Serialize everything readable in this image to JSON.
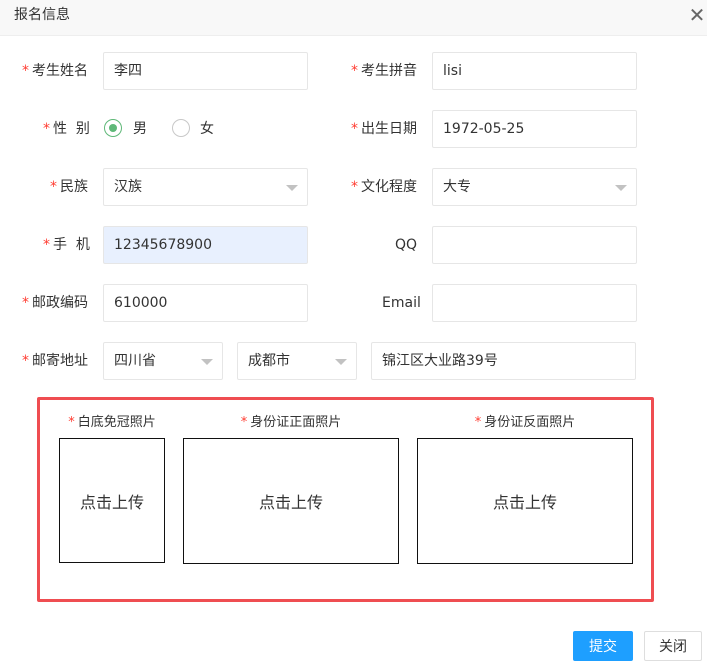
{
  "dialog": {
    "title": "报名信息",
    "close_symbol": "✕"
  },
  "form": {
    "name": {
      "label": "考生姓名",
      "value": "李四",
      "required": "*"
    },
    "pinyin": {
      "label": "考生拼音",
      "value": "lisi",
      "required": "*"
    },
    "gender": {
      "label": "性  别",
      "required": "*",
      "options": [
        {
          "label": "男",
          "checked": true
        },
        {
          "label": "女",
          "checked": false
        }
      ]
    },
    "birthdate": {
      "label": "出生日期",
      "value": "1972-05-25",
      "required": "*"
    },
    "ethnicity": {
      "label": "民族",
      "value": "汉族",
      "required": "*"
    },
    "education": {
      "label": "文化程度",
      "value": "大专",
      "required": "*"
    },
    "phone": {
      "label": "手  机",
      "value": "12345678900",
      "required": "*"
    },
    "qq": {
      "label": "QQ",
      "value": ""
    },
    "postcode": {
      "label": "邮政编码",
      "value": "610000",
      "required": "*"
    },
    "email": {
      "label": "Email",
      "value": ""
    },
    "address": {
      "label": "邮寄地址",
      "required": "*",
      "province": "四川省",
      "city": "成都市",
      "detail": "锦江区大业路39号"
    }
  },
  "uploads": {
    "accent_color": "#ef4d51",
    "photo": {
      "title": "白底免冠照片",
      "required": "*",
      "action": "点击上传"
    },
    "id_front": {
      "title": "身份证正面照片",
      "required": "*",
      "action": "点击上传"
    },
    "id_back": {
      "title": "身份证反面照片",
      "required": "*",
      "action": "点击上传"
    }
  },
  "footer": {
    "submit_label": "提交",
    "submit_color": "#1e9fff",
    "close_label": "关闭"
  }
}
